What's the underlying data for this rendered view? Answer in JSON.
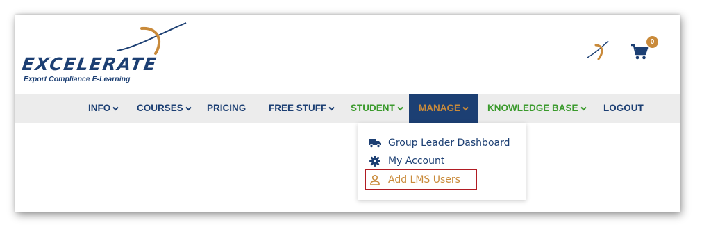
{
  "brand": {
    "name": "EXCELERATE",
    "tagline": "Export Compliance E-Learning",
    "primary_color": "#1c3f73",
    "accent_color": "#c98a3a"
  },
  "header": {
    "cart_icon": "cart-icon",
    "cart_count": "0"
  },
  "nav": {
    "items": [
      {
        "label": "INFO",
        "has_dropdown": true
      },
      {
        "label": "COURSES",
        "has_dropdown": true
      },
      {
        "label": "PRICING",
        "has_dropdown": false
      },
      {
        "label": "FREE STUFF",
        "has_dropdown": true
      },
      {
        "label": "STUDENT",
        "has_dropdown": true
      },
      {
        "label": "MANAGE",
        "has_dropdown": true,
        "active": true
      },
      {
        "label": "KNOWLEDGE BASE",
        "has_dropdown": true
      },
      {
        "label": "LOGOUT",
        "has_dropdown": false
      }
    ]
  },
  "manage_menu": {
    "items": [
      {
        "label": "Group Leader Dashboard",
        "icon": "truck-icon"
      },
      {
        "label": "My Account",
        "icon": "gear-icon"
      },
      {
        "label": "Add LMS Users",
        "icon": "user-icon",
        "highlighted": true
      }
    ]
  }
}
